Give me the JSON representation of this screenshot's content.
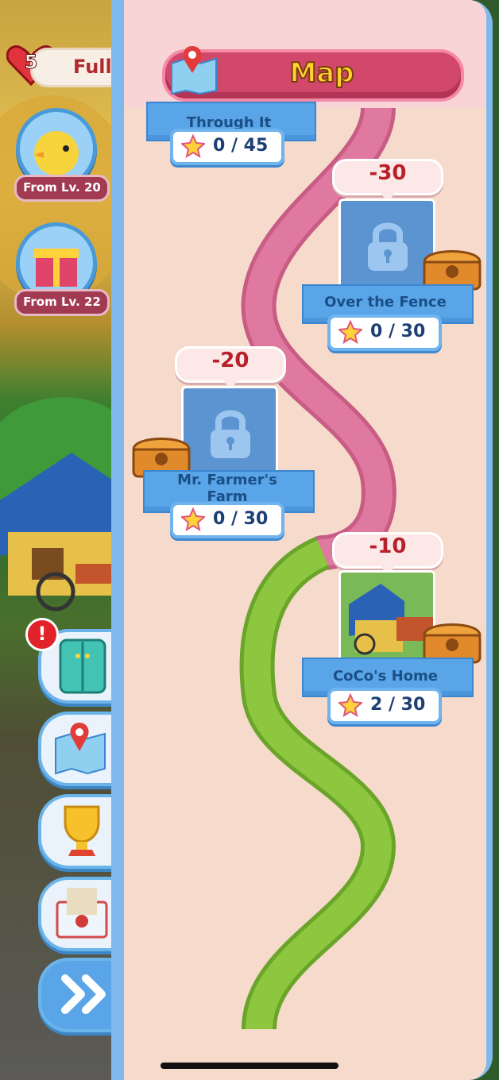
{
  "hud": {
    "lives": "5",
    "lives_status": "Full",
    "unlock_1": "From Lv. 20",
    "unlock_2": "From Lv. 22",
    "alert_mark": "!"
  },
  "side_buttons": [
    "wardrobe-icon",
    "map-icon",
    "trophy-icon",
    "mail-icon",
    "fast-forward-icon"
  ],
  "map": {
    "title": "Map",
    "stages": [
      {
        "name": "Water Gonna Through It",
        "name_visible": "Through It",
        "stars": "0 / 45",
        "cost": null,
        "locked": true
      },
      {
        "name": "Over the Fence",
        "stars": "0 / 30",
        "cost": "-30",
        "locked": true
      },
      {
        "name_line1": "Mr. Farmer's",
        "name_line2": "Farm",
        "stars": "0 / 30",
        "cost": "-20",
        "locked": true
      },
      {
        "name": "CoCo's Home",
        "stars": "2 / 30",
        "cost": "-10",
        "locked": false
      }
    ]
  },
  "colors": {
    "path_locked": "#e079a0",
    "path_unlocked": "#8dc63f",
    "panel": "#f6dacc",
    "header": "#d2486a",
    "title_text": "#ffd22e",
    "ribbon": "#5aa5e8",
    "cost_text": "#b6212b"
  }
}
